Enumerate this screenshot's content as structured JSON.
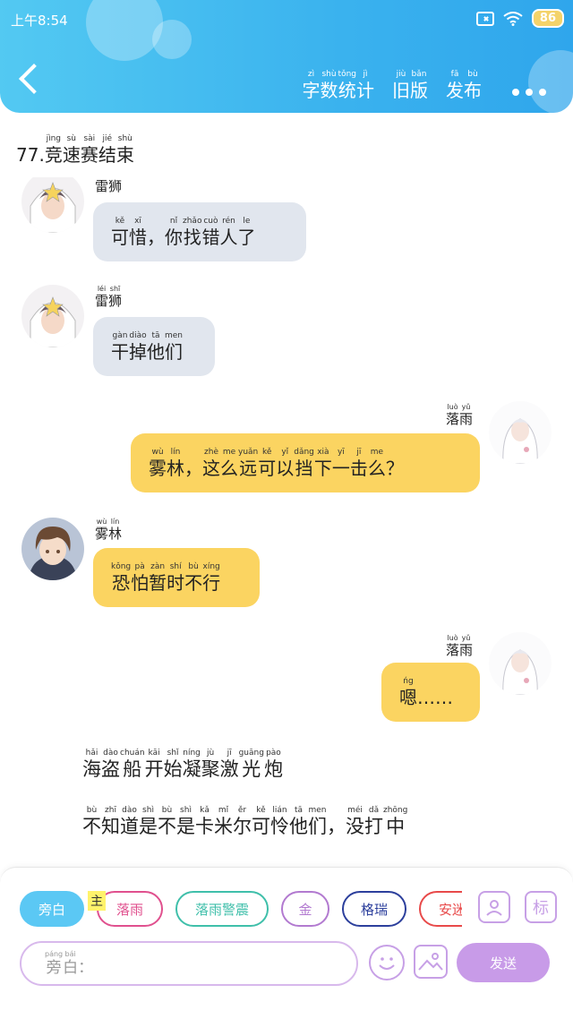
{
  "status_bar": {
    "time": "上午8:54",
    "battery": "86"
  },
  "header": {
    "actions": [
      {
        "hz": [
          "字",
          "数",
          "统",
          "计"
        ],
        "py": [
          "zì",
          "shù",
          "tǒng",
          "jì"
        ]
      },
      {
        "hz": [
          "旧",
          "版"
        ],
        "py": [
          "jiù",
          "bǎn"
        ]
      },
      {
        "hz": [
          "发",
          "布"
        ],
        "py": [
          "fā",
          "bù"
        ]
      }
    ]
  },
  "chapter": {
    "num": "77.",
    "hz": [
      "竞",
      "速",
      "赛",
      "结",
      "束"
    ],
    "py": [
      "jìng",
      "sù",
      "sài",
      "jié",
      "shù"
    ]
  },
  "messages": [
    {
      "side": "left",
      "name": {
        "hz": [
          "雷",
          "狮"
        ],
        "py": [
          "léi",
          "shī"
        ]
      },
      "avatar": "white-haired-boy-avatar",
      "color": "gray",
      "hz": [
        "可",
        "惜",
        "，",
        "你",
        "找",
        "错",
        "人",
        "了"
      ],
      "py": [
        "kě",
        "xī",
        "",
        "nǐ",
        "zhǎo",
        "cuò",
        "rén",
        "le"
      ]
    },
    {
      "side": "left",
      "name": {
        "hz": [
          "雷",
          "狮"
        ],
        "py": [
          "léi",
          "shī"
        ]
      },
      "avatar": "white-haired-boy-avatar",
      "color": "gray",
      "hz": [
        "干",
        "掉",
        "他",
        "们"
      ],
      "py": [
        "gàn",
        "diào",
        "tā",
        "men"
      ]
    },
    {
      "side": "right",
      "name": {
        "hz": [
          "落",
          "雨"
        ],
        "py": [
          "luò",
          "yǔ"
        ]
      },
      "avatar": "white-hoodie-girl-avatar",
      "color": "yellow",
      "hz": [
        "雾",
        "林",
        "，",
        "这",
        "么",
        "远",
        "可",
        "以",
        "挡",
        "下",
        "一",
        "击",
        "么",
        "？"
      ],
      "py": [
        "wù",
        "lín",
        "",
        "zhè",
        "me",
        "yuǎn",
        "kě",
        "yǐ",
        "dǎng",
        "xià",
        "yī",
        "jī",
        "me",
        ""
      ]
    },
    {
      "side": "left",
      "name": {
        "hz": [
          "雾",
          "林"
        ],
        "py": [
          "wù",
          "lín"
        ]
      },
      "avatar": "brown-haired-boy-avatar",
      "color": "yellow",
      "hz": [
        "恐",
        "怕",
        "暂",
        "时",
        "不",
        "行"
      ],
      "py": [
        "kǒng",
        "pà",
        "zàn",
        "shí",
        "bù",
        "xíng"
      ]
    },
    {
      "side": "right",
      "name": {
        "hz": [
          "落",
          "雨"
        ],
        "py": [
          "luò",
          "yǔ"
        ]
      },
      "avatar": "white-hoodie-girl-avatar",
      "color": "yellow",
      "hz": [
        "嗯",
        "…",
        "…"
      ],
      "py": [
        "ńg",
        "",
        ""
      ]
    }
  ],
  "narrations": [
    {
      "hz": [
        "海",
        "盗",
        "船",
        "开",
        "始",
        "凝",
        "聚",
        "激",
        "光",
        "炮"
      ],
      "py": [
        "hǎi",
        "dào",
        "chuán",
        "kāi",
        "shǐ",
        "níng",
        "jù",
        "jī",
        "guāng",
        "pào"
      ]
    },
    {
      "hz": [
        "不",
        "知",
        "道",
        "是",
        "不",
        "是",
        "卡",
        "米",
        "尔",
        "可",
        "怜",
        "他",
        "们",
        "，",
        "没",
        "打",
        "中"
      ],
      "py": [
        "bù",
        "zhī",
        "dào",
        "shì",
        "bù",
        "shì",
        "kǎ",
        "mǐ",
        "ěr",
        "kě",
        "lián",
        "tā",
        "men",
        "",
        "méi",
        "dǎ",
        "zhōng"
      ]
    }
  ],
  "bottom": {
    "roles": [
      {
        "label": "旁白",
        "color": "#5bc8f4",
        "active": true
      },
      {
        "label": "落雨",
        "color": "#e0508e",
        "active": false
      },
      {
        "label": "落雨警震",
        "color": "#3fbfaa",
        "active": false
      },
      {
        "label": "金",
        "color": "#b27ad0",
        "active": false
      },
      {
        "label": "格瑞",
        "color": "#2c3f9c",
        "active": false
      },
      {
        "label": "安迷",
        "color": "#e84a4a",
        "active": false
      }
    ],
    "main_badge": {
      "label": "主",
      "py": "zhǔ"
    },
    "side_icons": {
      "character": "person-icon",
      "mark": "标"
    },
    "input": {
      "placeholder_hz": "旁白：",
      "placeholder_py": [
        "páng",
        "bái"
      ]
    },
    "send_label": "发送",
    "colors": {
      "accent": "#c89be8",
      "header": "#3ab2ee"
    }
  }
}
